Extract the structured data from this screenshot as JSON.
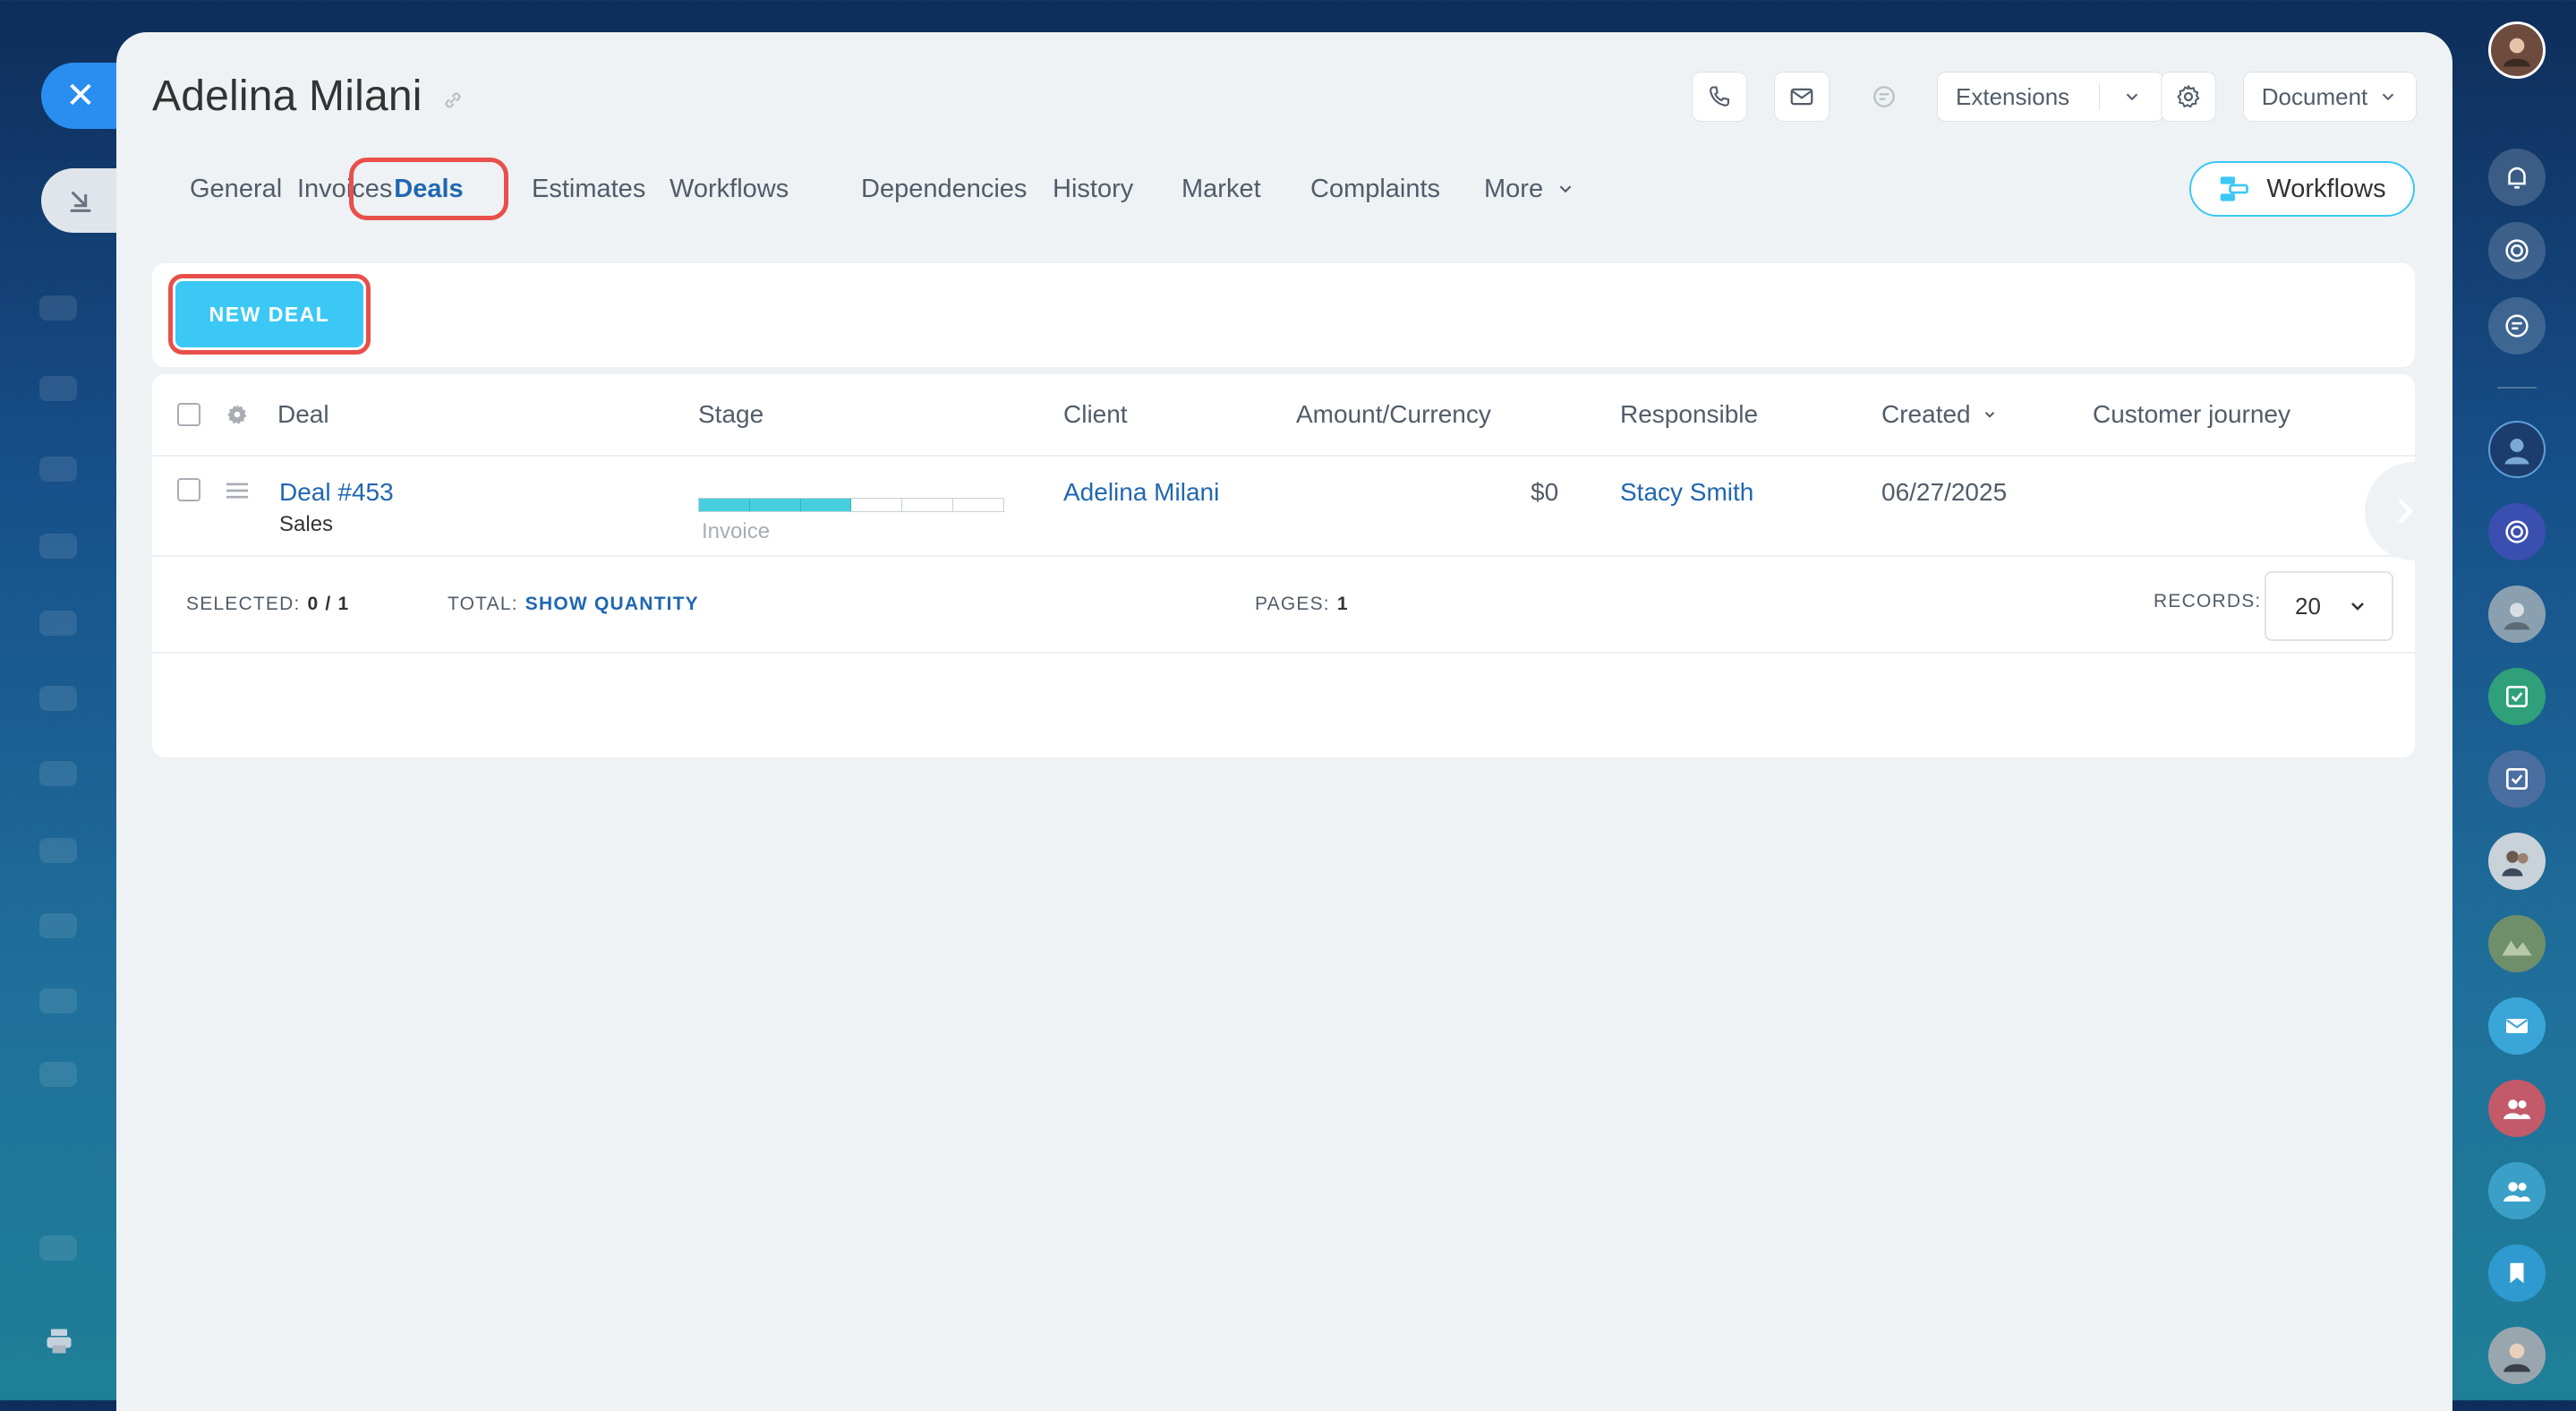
{
  "header": {
    "title": "Adelina Milani",
    "extensions_label": "Extensions",
    "document_label": "Document"
  },
  "tabs": [
    {
      "label": "General"
    },
    {
      "label": "Invoices"
    },
    {
      "label": "Deals",
      "active": true
    },
    {
      "label": "Estimates"
    },
    {
      "label": "Workflows"
    },
    {
      "label": "Dependencies"
    },
    {
      "label": "History"
    },
    {
      "label": "Market"
    },
    {
      "label": "Complaints"
    },
    {
      "label": "More"
    }
  ],
  "workflows_button": "Workflows",
  "toolbar": {
    "new_deal_label": "NEW DEAL"
  },
  "grid": {
    "columns": [
      "Deal",
      "Stage",
      "Client",
      "Amount/Currency",
      "Responsible",
      "Created",
      "Customer journey"
    ],
    "rows": [
      {
        "deal": "Deal #453",
        "pipeline": "Sales",
        "stage_label": "Invoice",
        "stage_progress": {
          "filled_segments": 3,
          "total_segments": 6
        },
        "client": "Adelina Milani",
        "amount": "$0",
        "responsible": "Stacy Smith",
        "created": "06/27/2025"
      }
    ]
  },
  "footer": {
    "selected_label": "SELECTED:",
    "selected_value": "0 / 1",
    "total_label": "TOTAL:",
    "total_link": "SHOW QUANTITY",
    "pages_label": "PAGES:",
    "pages_value": "1",
    "records_label": "RECORDS:",
    "records_value": "20"
  },
  "colors": {
    "accent": "#3bc8f5",
    "link": "#2067b0",
    "highlight": "#e8504b",
    "close_button": "#2a8ef0"
  }
}
